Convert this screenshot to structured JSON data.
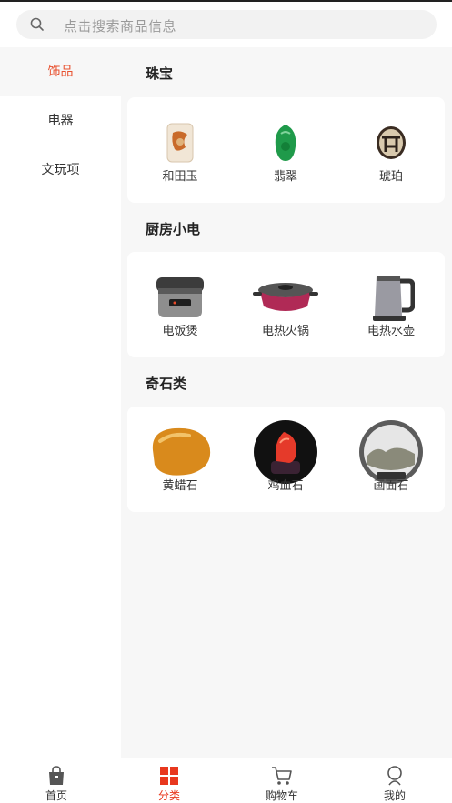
{
  "search": {
    "placeholder": "点击搜索商品信息"
  },
  "sidebar": {
    "items": [
      {
        "label": "饰品",
        "active": true
      },
      {
        "label": "电器",
        "active": false
      },
      {
        "label": "文玩项",
        "active": false
      }
    ]
  },
  "sections": [
    {
      "title": "珠宝",
      "items": [
        {
          "label": "和田玉",
          "icon": "hetian-jade-image"
        },
        {
          "label": "翡翠",
          "icon": "jadeite-image"
        },
        {
          "label": "琥珀",
          "icon": "amber-image"
        }
      ]
    },
    {
      "title": "厨房小电",
      "items": [
        {
          "label": "电饭煲",
          "icon": "rice-cooker-image"
        },
        {
          "label": "电热火锅",
          "icon": "hotpot-image"
        },
        {
          "label": "电热水壶",
          "icon": "kettle-image"
        }
      ]
    },
    {
      "title": "奇石类",
      "items": [
        {
          "label": "黄蜡石",
          "icon": "yellow-wax-stone-image"
        },
        {
          "label": "鸡血石",
          "icon": "bloodstone-image"
        },
        {
          "label": "画面石",
          "icon": "picture-stone-image"
        }
      ]
    }
  ],
  "tabbar": {
    "items": [
      {
        "label": "首页",
        "icon": "shopping-bag-icon"
      },
      {
        "label": "分类",
        "icon": "category-grid-icon",
        "active": true
      },
      {
        "label": "购物车",
        "icon": "cart-icon"
      },
      {
        "label": "我的",
        "icon": "profile-icon"
      }
    ]
  },
  "colors": {
    "accent": "#e8502e",
    "tab_active": "#e8381e",
    "content_bg": "#f7f7f7"
  }
}
